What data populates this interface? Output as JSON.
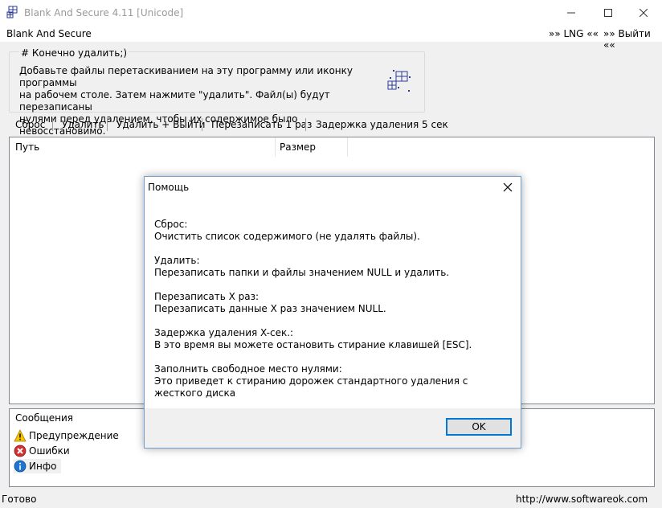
{
  "window": {
    "title": "Blank And Secure 4.11 [Unicode]",
    "icon": "app-grid-icon"
  },
  "menubar": {
    "app_label": "Blank And Secure",
    "lng_label": "»» LNG ««",
    "exit_label": "»» Выйти ««"
  },
  "group": {
    "title": "# Конечно удалить;)",
    "text_line1": "Добавьте файлы перетаскиванием на эту программу или иконку программы",
    "text_line2": "на рабочем столе. Затем нажмите \"удалить\". Файл(ы) будут перезаписаны",
    "text_line3": "нулями перед удалением, чтобы их содержимое было невосстановимо.",
    "icon": "drop-target-icon"
  },
  "toolbar": {
    "reset": "Сброс",
    "delete": "Удалить",
    "delete_exit": "Удалить + Выйти",
    "overwrite": "Перезаписать 1 раз",
    "delay": "Задержка удаления 5 сек"
  },
  "list": {
    "columns": [
      "Путь",
      "Размер"
    ]
  },
  "messages": {
    "title": "Сообщения",
    "items": [
      {
        "label": "Предупреждение",
        "icon": "warning-icon"
      },
      {
        "label": "Ошибки",
        "icon": "error-icon"
      },
      {
        "label": "Инфо",
        "icon": "info-icon"
      }
    ]
  },
  "statusbar": {
    "status": "Готово",
    "url": "http://www.softwareok.com"
  },
  "dialog": {
    "title": "Помощь",
    "sections": [
      {
        "heading": "Сброс:",
        "text": "Очистить список содержимого (не удалять файлы)."
      },
      {
        "heading": "Удалить:",
        "text": "Перезаписать папки и файлы значением NULL и удалить."
      },
      {
        "heading": "Перезаписать X раз:",
        "text": "Перезаписать данные X раз значением NULL."
      },
      {
        "heading": "Задержка удаления X-сек.:",
        "text": "В это время вы можете остановить стирание клавишей [ESC]."
      },
      {
        "heading": "Заполнить свободное место нулями:",
        "text": "Это приведет к стиранию дорожек стандартного удаления с жесткого диска"
      }
    ],
    "ok_label": "OK"
  }
}
